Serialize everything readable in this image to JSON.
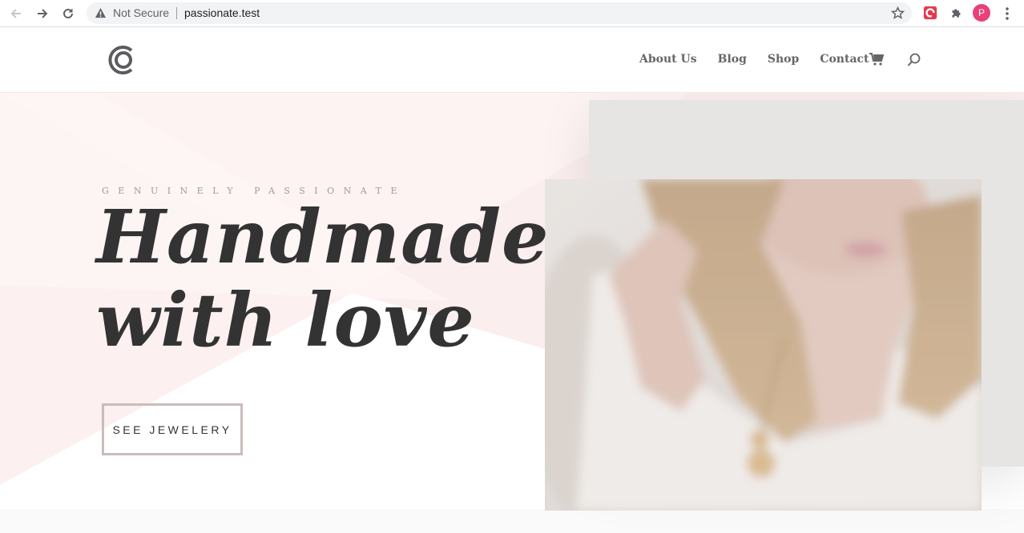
{
  "browser": {
    "security_label": "Not Secure",
    "url": "passionate.test",
    "profile_initial": "P"
  },
  "icons": {
    "back": "arrow-left-icon",
    "forward": "arrow-right-icon",
    "reload": "reload-icon",
    "warning": "warning-triangle-icon",
    "bookmark": "star-icon",
    "extension_a": "red-extension-icon",
    "extensions": "puzzle-icon",
    "menu": "kebab-menu-icon",
    "logo": "c-logo-icon",
    "cart": "cart-icon",
    "search": "search-icon"
  },
  "nav": {
    "items": [
      {
        "label": "About Us"
      },
      {
        "label": "Blog"
      },
      {
        "label": "Shop"
      },
      {
        "label": "Contact"
      }
    ]
  },
  "hero": {
    "eyebrow": "GENUINELY PASSIONATE",
    "headline_line1": "Handmade",
    "headline_line2": "with love",
    "cta_label": "SEE JEWELERY"
  },
  "colors": {
    "accent_pink": "#fbeeee",
    "cta_border": "#cbbcbc",
    "profile": "#e8417a"
  }
}
